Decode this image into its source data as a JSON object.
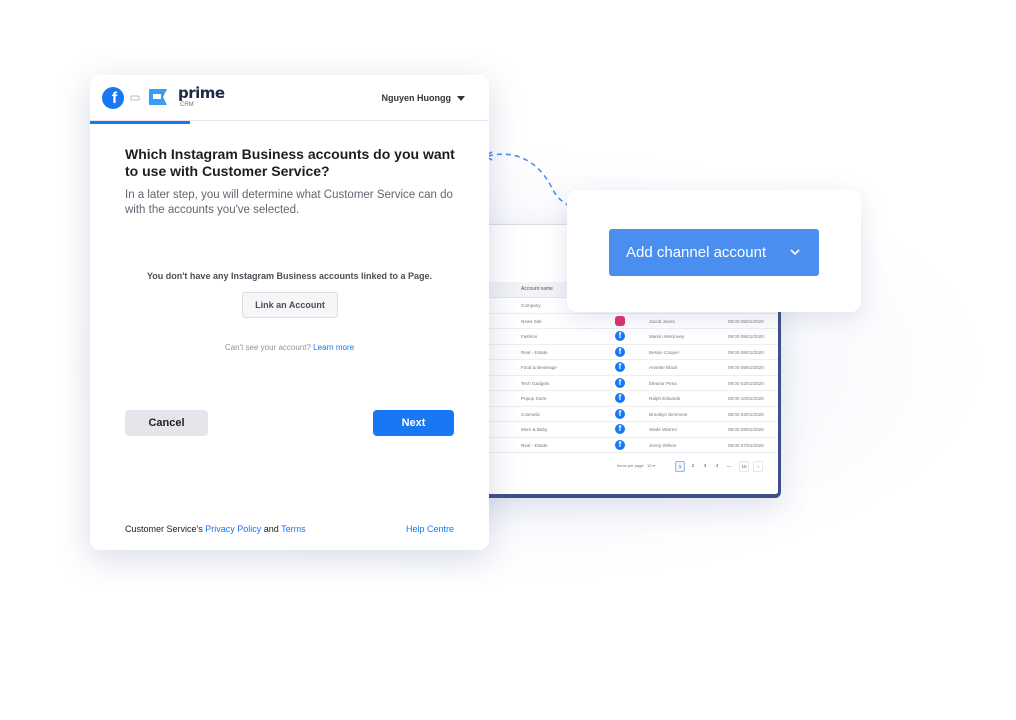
{
  "dialog": {
    "user_name": "Nguyen Huongg",
    "logo_text": "prime",
    "logo_sub": "CRM",
    "title": "Which Instagram Business accounts do you want to use with Customer Service?",
    "description": "In a later step, you will determine what Customer Service can do with the accounts you've selected.",
    "empty_message": "You don't have any Instagram Business accounts linked to a Page.",
    "link_account_label": "Link an Account",
    "help_prefix": "Can't see your account?",
    "help_link": "Learn more",
    "cancel_label": "Cancel",
    "next_label": "Next",
    "footer_prefix": "Customer Service's",
    "privacy_link": "Privacy Policy",
    "footer_and": "and",
    "terms_link": "Terms",
    "help_centre_link": "Help Centre"
  },
  "channel_card": {
    "button_label": "Add channel account"
  },
  "table": {
    "header": {
      "account_name": "Account name"
    },
    "rows": [
      {
        "account": "Company",
        "icon": "none",
        "name": "",
        "time": ""
      },
      {
        "account": "News Site",
        "icon": "instagram",
        "name": "Jacob Jones",
        "time": "09:00 05/01/2020"
      },
      {
        "account": "Fashion",
        "icon": "facebook",
        "name": "Marvin McKinney",
        "time": "08:00 08/01/2020"
      },
      {
        "account": "Real - Estate",
        "icon": "facebook",
        "name": "Bessie Cooper",
        "time": "09:00 08/01/2020"
      },
      {
        "account": "Food & Beverage",
        "icon": "facebook",
        "name": "Annette Black",
        "time": "09:00 09/01/2020"
      },
      {
        "account": "Tech Gadgets",
        "icon": "facebook",
        "name": "Eleanor Pena",
        "time": "09:00 02/01/2020"
      },
      {
        "account": "Popup Store",
        "icon": "facebook",
        "name": "Ralph Edwards",
        "time": "09:00 10/01/2020"
      },
      {
        "account": "Cosmetic",
        "icon": "facebook",
        "name": "Brooklyn Simmons",
        "time": "08:00 03/01/2020"
      },
      {
        "account": "Mom & Baby",
        "icon": "facebook",
        "name": "Wade Warren",
        "time": "08:00 09/01/2020"
      },
      {
        "account": "Real - Estate",
        "icon": "facebook",
        "name": "Jenny Wilson",
        "time": "09:00 07/01/2020"
      }
    ],
    "pager": {
      "per_page_label": "Items per page",
      "per_page_value": "10",
      "pages": [
        "1",
        "2",
        "3",
        "4",
        "...",
        "10"
      ]
    }
  },
  "colors": {
    "facebook_blue": "#1877f2",
    "channel_button": "#4a8ef0",
    "panel_border": "#3e4f8a"
  }
}
